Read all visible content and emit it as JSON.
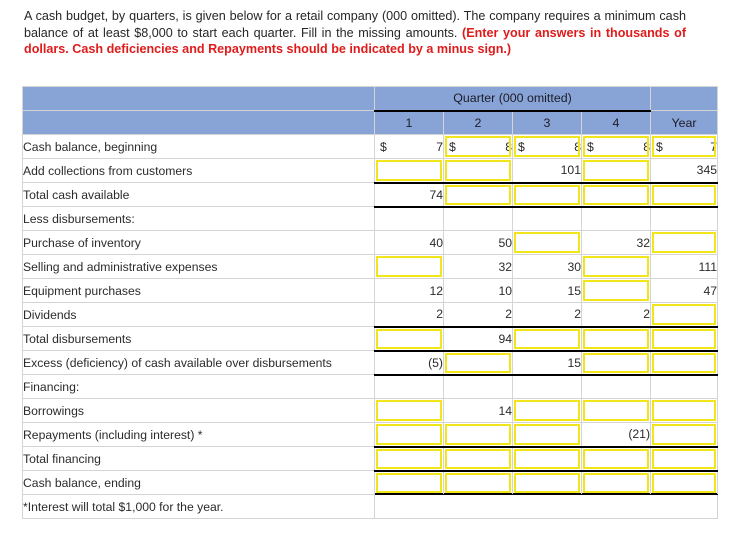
{
  "prompt": {
    "plain": "A cash budget, by quarters, is given below for a retail company (000 omitted). The company requires a minimum cash balance of at least $8,000 to start each quarter. Fill in the missing amounts. ",
    "required": "(Enter your answers in thousands of dollars. Cash deficiencies and Repayments should be indicated by a minus sign.)"
  },
  "table": {
    "group_header": "Quarter (000 omitted)",
    "corner_header": "",
    "columns": [
      "1",
      "2",
      "3",
      "4",
      "Year"
    ],
    "header_color": "#88A4D6",
    "input_border_color": "#F2E519",
    "rows": [
      {
        "label": "Cash balance, beginning",
        "indent": false,
        "cells": [
          {
            "dollar": "$",
            "value": "7",
            "input": false
          },
          {
            "dollar": "$",
            "value": "8",
            "input": true
          },
          {
            "dollar": "$",
            "value": "8",
            "input": true
          },
          {
            "dollar": "$",
            "value": "8",
            "input": true
          },
          {
            "dollar": "$",
            "value": "7",
            "input": true
          }
        ]
      },
      {
        "label": "Add collections from customers",
        "indent": false,
        "cells": [
          {
            "dollar": "",
            "value": "",
            "input": true
          },
          {
            "dollar": "",
            "value": "",
            "input": true
          },
          {
            "dollar": "",
            "value": "101",
            "input": false
          },
          {
            "dollar": "",
            "value": "",
            "input": true
          },
          {
            "dollar": "",
            "value": "345",
            "input": false
          }
        ]
      },
      {
        "label": "Total cash available",
        "indent": false,
        "rule": "top-bottom",
        "cells": [
          {
            "dollar": "",
            "value": "74",
            "input": false
          },
          {
            "dollar": "",
            "value": "",
            "input": true
          },
          {
            "dollar": "",
            "value": "",
            "input": true
          },
          {
            "dollar": "",
            "value": "",
            "input": true
          },
          {
            "dollar": "",
            "value": "",
            "input": true
          }
        ]
      },
      {
        "label": "Less disbursements:",
        "indent": false,
        "cells": [
          {
            "dollar": "",
            "value": "",
            "input": false
          },
          {
            "dollar": "",
            "value": "",
            "input": false
          },
          {
            "dollar": "",
            "value": "",
            "input": false
          },
          {
            "dollar": "",
            "value": "",
            "input": false
          },
          {
            "dollar": "",
            "value": "",
            "input": false
          }
        ]
      },
      {
        "label": "Purchase of inventory",
        "indent": true,
        "cells": [
          {
            "dollar": "",
            "value": "40",
            "input": false
          },
          {
            "dollar": "",
            "value": "50",
            "input": false
          },
          {
            "dollar": "",
            "value": "",
            "input": true
          },
          {
            "dollar": "",
            "value": "32",
            "input": false
          },
          {
            "dollar": "",
            "value": "",
            "input": true
          }
        ]
      },
      {
        "label": "Selling and administrative expenses",
        "indent": true,
        "cells": [
          {
            "dollar": "",
            "value": "",
            "input": true
          },
          {
            "dollar": "",
            "value": "32",
            "input": false
          },
          {
            "dollar": "",
            "value": "30",
            "input": false
          },
          {
            "dollar": "",
            "value": "",
            "input": true
          },
          {
            "dollar": "",
            "value": "111",
            "input": false
          }
        ]
      },
      {
        "label": "Equipment purchases",
        "indent": true,
        "cells": [
          {
            "dollar": "",
            "value": "12",
            "input": false
          },
          {
            "dollar": "",
            "value": "10",
            "input": false
          },
          {
            "dollar": "",
            "value": "15",
            "input": false
          },
          {
            "dollar": "",
            "value": "",
            "input": true
          },
          {
            "dollar": "",
            "value": "47",
            "input": false
          }
        ]
      },
      {
        "label": "Dividends",
        "indent": true,
        "cells": [
          {
            "dollar": "",
            "value": "2",
            "input": false
          },
          {
            "dollar": "",
            "value": "2",
            "input": false
          },
          {
            "dollar": "",
            "value": "2",
            "input": false
          },
          {
            "dollar": "",
            "value": "2",
            "input": false
          },
          {
            "dollar": "",
            "value": "",
            "input": true
          }
        ]
      },
      {
        "label": "Total disbursements",
        "indent": false,
        "rule": "top",
        "cells": [
          {
            "dollar": "",
            "value": "",
            "input": true
          },
          {
            "dollar": "",
            "value": "94",
            "input": false
          },
          {
            "dollar": "",
            "value": "",
            "input": true
          },
          {
            "dollar": "",
            "value": "",
            "input": true
          },
          {
            "dollar": "",
            "value": "",
            "input": true
          }
        ]
      },
      {
        "label": "Excess (deficiency) of cash available over disbursements",
        "indent": false,
        "rule": "top-bottom",
        "cells": [
          {
            "dollar": "",
            "value": "(5)",
            "input": false
          },
          {
            "dollar": "",
            "value": "",
            "input": true
          },
          {
            "dollar": "",
            "value": "15",
            "input": false
          },
          {
            "dollar": "",
            "value": "",
            "input": true
          },
          {
            "dollar": "",
            "value": "",
            "input": true
          }
        ]
      },
      {
        "label": "Financing:",
        "indent": false,
        "cells": [
          {
            "dollar": "",
            "value": "",
            "input": false
          },
          {
            "dollar": "",
            "value": "",
            "input": false
          },
          {
            "dollar": "",
            "value": "",
            "input": false
          },
          {
            "dollar": "",
            "value": "",
            "input": false
          },
          {
            "dollar": "",
            "value": "",
            "input": false
          }
        ]
      },
      {
        "label": "Borrowings",
        "indent": true,
        "cells": [
          {
            "dollar": "",
            "value": "",
            "input": true
          },
          {
            "dollar": "",
            "value": "14",
            "input": false
          },
          {
            "dollar": "",
            "value": "",
            "input": true
          },
          {
            "dollar": "",
            "value": "",
            "input": true
          },
          {
            "dollar": "",
            "value": "",
            "input": true
          }
        ]
      },
      {
        "label": "Repayments (including interest) *",
        "indent": true,
        "cells": [
          {
            "dollar": "",
            "value": "",
            "input": true
          },
          {
            "dollar": "",
            "value": "",
            "input": true
          },
          {
            "dollar": "",
            "value": "",
            "input": true
          },
          {
            "dollar": "",
            "value": "(21)",
            "input": false
          },
          {
            "dollar": "",
            "value": "",
            "input": true
          }
        ]
      },
      {
        "label": "Total financing",
        "indent": false,
        "rule": "top",
        "cells": [
          {
            "dollar": "",
            "value": "",
            "input": true
          },
          {
            "dollar": "",
            "value": "",
            "input": true
          },
          {
            "dollar": "",
            "value": "",
            "input": true
          },
          {
            "dollar": "",
            "value": "",
            "input": true
          },
          {
            "dollar": "",
            "value": "",
            "input": true
          }
        ]
      },
      {
        "label": "Cash balance, ending",
        "indent": false,
        "rule": "top-double",
        "cells": [
          {
            "dollar": "",
            "value": "",
            "input": true
          },
          {
            "dollar": "",
            "value": "",
            "input": true
          },
          {
            "dollar": "",
            "value": "",
            "input": true
          },
          {
            "dollar": "",
            "value": "",
            "input": true
          },
          {
            "dollar": "",
            "value": "",
            "input": true
          }
        ]
      }
    ],
    "footnote": "*Interest will total $1,000 for the year."
  }
}
